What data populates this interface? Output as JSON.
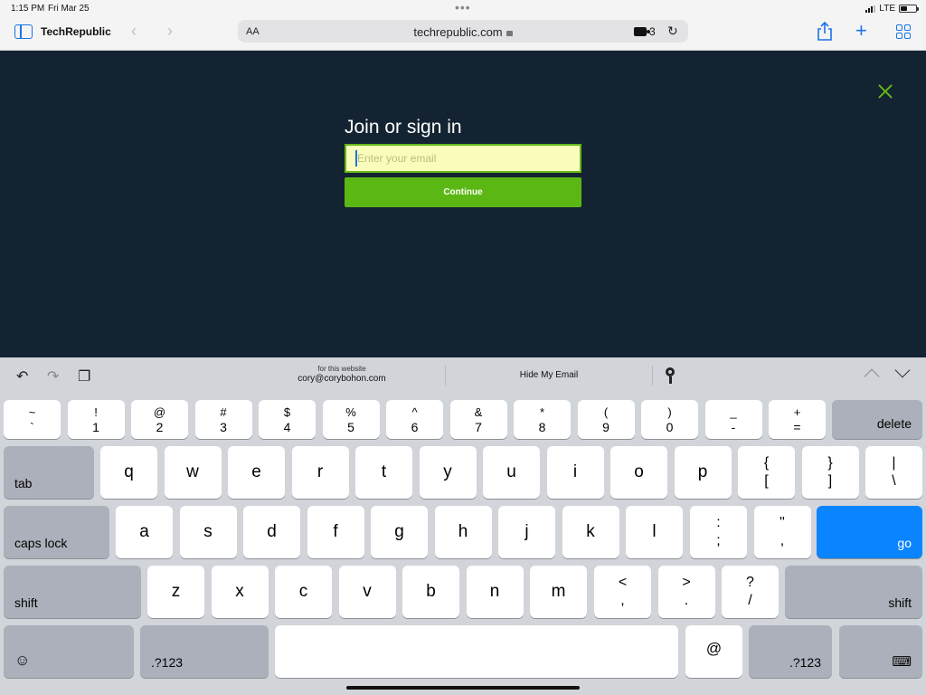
{
  "status_bar": {
    "time": "1:15 PM",
    "date": "Fri Mar 25",
    "network": "LTE",
    "battery_level": 0.45
  },
  "toolbar": {
    "title": "TechRepublic",
    "text_size": "AA",
    "url": "techrepublic.com",
    "extensions_count": "3",
    "icons": [
      "sidebar-icon",
      "back-icon",
      "forward-icon",
      "lock-icon",
      "extension-icon",
      "reload-icon",
      "share-icon",
      "new-tab-icon",
      "tabs-icon"
    ]
  },
  "page": {
    "heading": "Join or sign in",
    "email_placeholder": "Enter your email",
    "email_value": "",
    "continue_label": "Continue",
    "accent_color": "#64b818",
    "background_color": "#132332"
  },
  "keyboard": {
    "suggestions": {
      "account_caption": "for this website",
      "account_email": "cory@corybohon.com",
      "hide_email": "Hide My Email"
    },
    "number_row": [
      {
        "top": "~",
        "bottom": "`"
      },
      {
        "top": "!",
        "bottom": "1"
      },
      {
        "top": "@",
        "bottom": "2"
      },
      {
        "top": "#",
        "bottom": "3"
      },
      {
        "top": "$",
        "bottom": "4"
      },
      {
        "top": "%",
        "bottom": "5"
      },
      {
        "top": "^",
        "bottom": "6"
      },
      {
        "top": "&",
        "bottom": "7"
      },
      {
        "top": "*",
        "bottom": "8"
      },
      {
        "top": "(",
        "bottom": "9"
      },
      {
        "top": ")",
        "bottom": "0"
      },
      {
        "top": "_",
        "bottom": "-"
      },
      {
        "top": "+",
        "bottom": "="
      }
    ],
    "delete_label": "delete",
    "tab_label": "tab",
    "qwerty_row": [
      "q",
      "w",
      "e",
      "r",
      "t",
      "y",
      "u",
      "i",
      "o",
      "p"
    ],
    "bracket_keys": [
      {
        "top": "{",
        "bottom": "["
      },
      {
        "top": "}",
        "bottom": "]"
      },
      {
        "top": "|",
        "bottom": "\\"
      }
    ],
    "caps_label": "caps lock",
    "home_row": [
      "a",
      "s",
      "d",
      "f",
      "g",
      "h",
      "j",
      "k",
      "l"
    ],
    "home_punct": [
      {
        "top": ":",
        "bottom": ";"
      },
      {
        "top": "\"",
        "bottom": ","
      }
    ],
    "go_label": "go",
    "shift_label": "shift",
    "bottom_row": [
      "z",
      "x",
      "c",
      "v",
      "b",
      "n",
      "m"
    ],
    "bottom_punct": [
      {
        "top": "<",
        "bottom": ","
      },
      {
        "top": ">",
        "bottom": "."
      },
      {
        "top": "?",
        "bottom": "/"
      }
    ],
    "numbers_label": ".?123",
    "at_label": "@"
  }
}
